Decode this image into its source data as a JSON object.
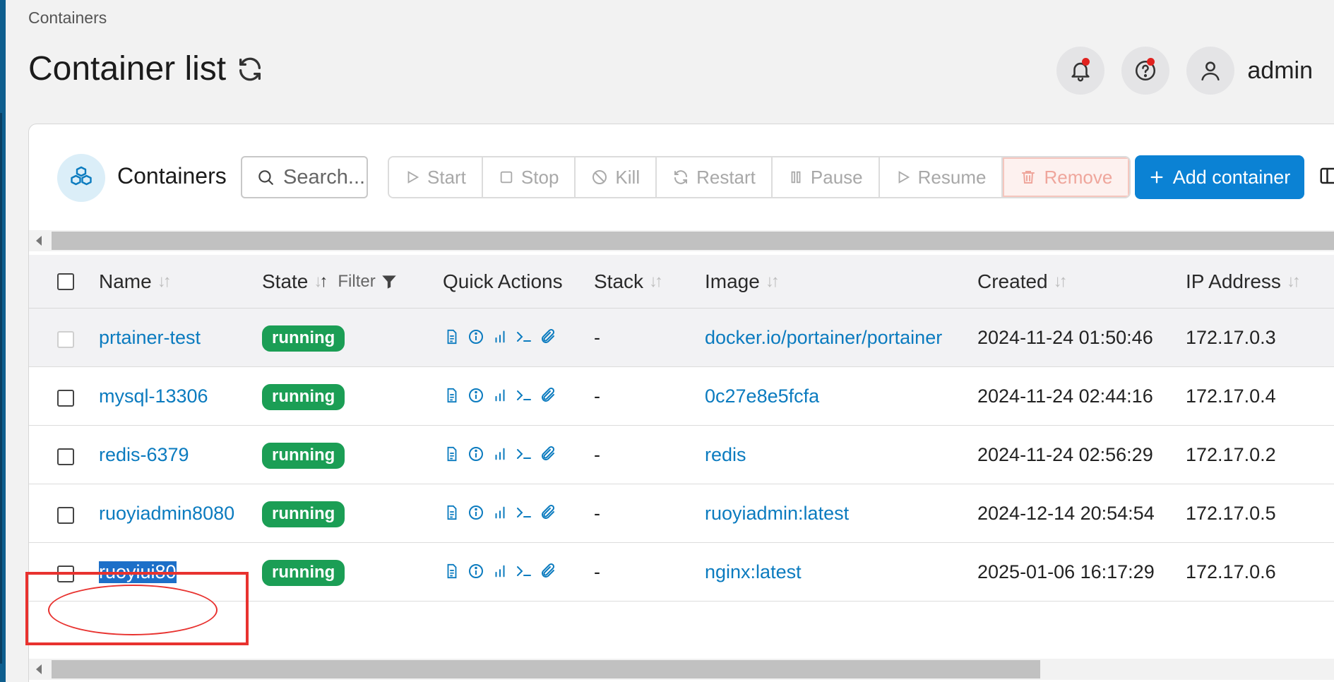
{
  "breadcrumb": "Containers",
  "page": {
    "title": "Container list"
  },
  "user": {
    "name": "admin"
  },
  "panel": {
    "title": "Containers",
    "search_placeholder": "Search...",
    "actions": {
      "start": "Start",
      "stop": "Stop",
      "kill": "Kill",
      "restart": "Restart",
      "pause": "Pause",
      "resume": "Resume",
      "remove": "Remove"
    },
    "add_label": "Add container"
  },
  "table": {
    "headers": {
      "name": "Name",
      "state": "State",
      "filter": "Filter",
      "quick_actions": "Quick Actions",
      "stack": "Stack",
      "image": "Image",
      "created": "Created",
      "ip": "IP Address"
    },
    "rows": [
      {
        "name": "prtainer-test",
        "state": "running",
        "stack": "-",
        "image": "docker.io/portainer/portainer",
        "created": "2024-11-24 01:50:46",
        "ip": "172.17.0.3"
      },
      {
        "name": "mysql-13306",
        "state": "running",
        "stack": "-",
        "image": "0c27e8e5fcfa",
        "created": "2024-11-24 02:44:16",
        "ip": "172.17.0.4"
      },
      {
        "name": "redis-6379",
        "state": "running",
        "stack": "-",
        "image": "redis",
        "created": "2024-11-24 02:56:29",
        "ip": "172.17.0.2"
      },
      {
        "name": "ruoyiadmin8080",
        "state": "running",
        "stack": "-",
        "image": "ruoyiadmin:latest",
        "created": "2024-12-14 20:54:54",
        "ip": "172.17.0.5"
      },
      {
        "name": "ruoyiui80",
        "state": "running",
        "stack": "-",
        "image": "nginx:latest",
        "created": "2025-01-06 16:17:29",
        "ip": "172.17.0.6"
      }
    ]
  },
  "colors": {
    "accent": "#0b82d4",
    "running": "#1b9e55",
    "link": "#0b7bbf",
    "annotation": "#e8322f"
  }
}
